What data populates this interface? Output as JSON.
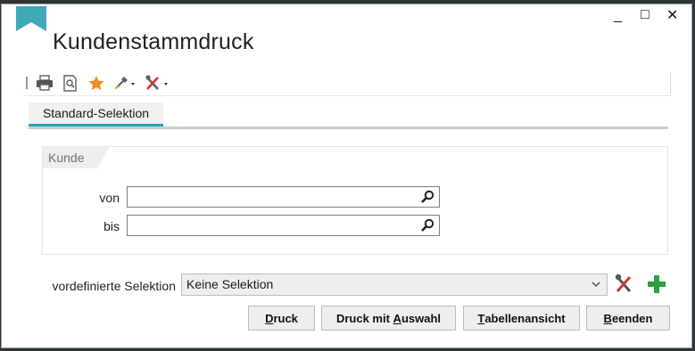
{
  "window": {
    "title": "Kundenstammdruck",
    "controls": {
      "minimize": "_",
      "maximize": "□",
      "close": "✕"
    }
  },
  "toolbar": {
    "icons": [
      "printer-icon",
      "preview-icon",
      "favorite-star-icon",
      "brush-dropdown-icon",
      "tools-dropdown-icon"
    ]
  },
  "tabs": [
    {
      "label": "Standard-Selektion",
      "active": true
    }
  ],
  "kunde_group": {
    "legend": "Kunde",
    "von_label": "von",
    "von_value": "",
    "bis_label": "bis",
    "bis_value": ""
  },
  "selection": {
    "label": "vordefinierte Selektion",
    "value": "Keine Selektion"
  },
  "buttons": {
    "druck": {
      "pre": "",
      "key": "D",
      "post": "ruck"
    },
    "druck_auswahl": {
      "pre": "Druck mit ",
      "key": "A",
      "post": "uswahl"
    },
    "tabellenansicht": {
      "pre": "",
      "key": "T",
      "post": "abellenansicht"
    },
    "beenden": {
      "pre": "",
      "key": "B",
      "post": "eenden"
    }
  },
  "colors": {
    "accent_teal": "#2aa3b8",
    "add_green": "#2e9e3e",
    "star_orange": "#f08a24",
    "frame_dark": "#2e3336"
  }
}
